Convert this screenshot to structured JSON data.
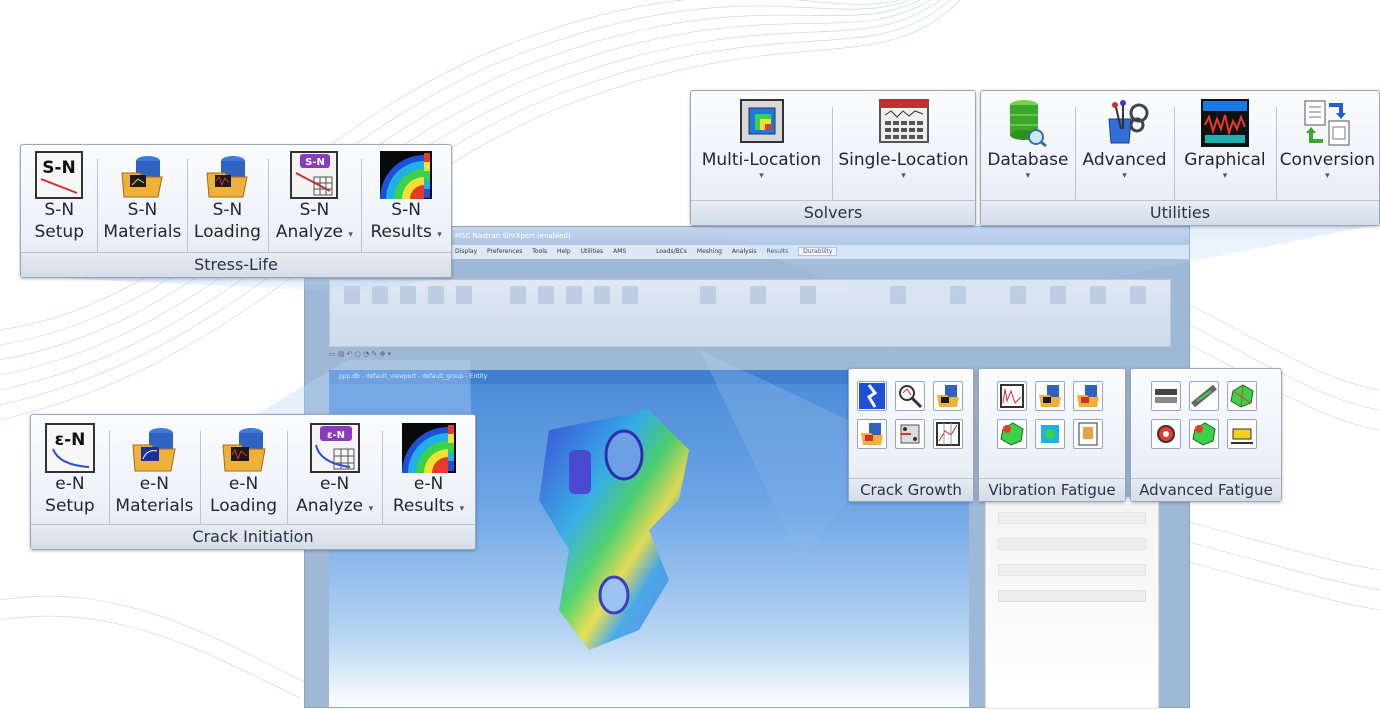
{
  "app": {
    "title": "MSC Nastran SimXpert (enabled)",
    "menu": [
      "Display",
      "Preferences",
      "Tools",
      "Help",
      "Utilities",
      "AMS"
    ],
    "tabs": [
      "Loads/BCs",
      "Meshing",
      "Analysis",
      "Results",
      "Durability"
    ],
    "viewport_title": "ppp.db - default_viewport - default_group - Entity"
  },
  "stress_life": {
    "title": "Stress-Life",
    "buttons": [
      {
        "line1": "S-N",
        "line2": "Setup",
        "icon": "sn-setup-icon",
        "dropdown": false
      },
      {
        "line1": "S-N",
        "line2": "Materials",
        "icon": "sn-materials-icon",
        "dropdown": false
      },
      {
        "line1": "S-N",
        "line2": "Loading",
        "icon": "sn-loading-icon",
        "dropdown": false
      },
      {
        "line1": "S-N",
        "line2": "Analyze",
        "icon": "sn-analyze-icon",
        "dropdown": true
      },
      {
        "line1": "S-N",
        "line2": "Results",
        "icon": "sn-results-icon",
        "dropdown": true
      }
    ],
    "icon_texts": {
      "setup": "S-N",
      "analyze": "S-N"
    }
  },
  "crack_initiation": {
    "title": "Crack Initiation",
    "buttons": [
      {
        "line1": "e-N",
        "line2": "Setup",
        "icon": "en-setup-icon",
        "dropdown": false
      },
      {
        "line1": "e-N",
        "line2": "Materials",
        "icon": "en-materials-icon",
        "dropdown": false
      },
      {
        "line1": "e-N",
        "line2": "Loading",
        "icon": "en-loading-icon",
        "dropdown": false
      },
      {
        "line1": "e-N",
        "line2": "Analyze",
        "icon": "en-analyze-icon",
        "dropdown": true
      },
      {
        "line1": "e-N",
        "line2": "Results",
        "icon": "en-results-icon",
        "dropdown": true
      }
    ],
    "icon_texts": {
      "setup": "ε-N",
      "analyze": "ε-N"
    }
  },
  "solvers": {
    "title": "Solvers",
    "buttons": [
      {
        "label": "Multi-Location",
        "icon": "multi-location-icon"
      },
      {
        "label": "Single-Location",
        "icon": "single-location-icon"
      }
    ]
  },
  "utilities": {
    "title": "Utilities",
    "buttons": [
      {
        "label": "Database",
        "icon": "database-icon"
      },
      {
        "label": "Advanced",
        "icon": "advanced-icon"
      },
      {
        "label": "Graphical",
        "icon": "graphical-icon"
      },
      {
        "label": "Conversion",
        "icon": "conversion-icon"
      }
    ]
  },
  "crack_growth": {
    "title": "Crack Growth"
  },
  "vibration_fatigue": {
    "title": "Vibration Fatigue"
  },
  "advanced_fatigue": {
    "title": "Advanced Fatigue"
  },
  "dropdown_glyph": "▾",
  "colors": {
    "ribbon_border": "#9aa7ba",
    "accent_blue": "#1f5fd0",
    "purple": "#8a3bbd"
  }
}
